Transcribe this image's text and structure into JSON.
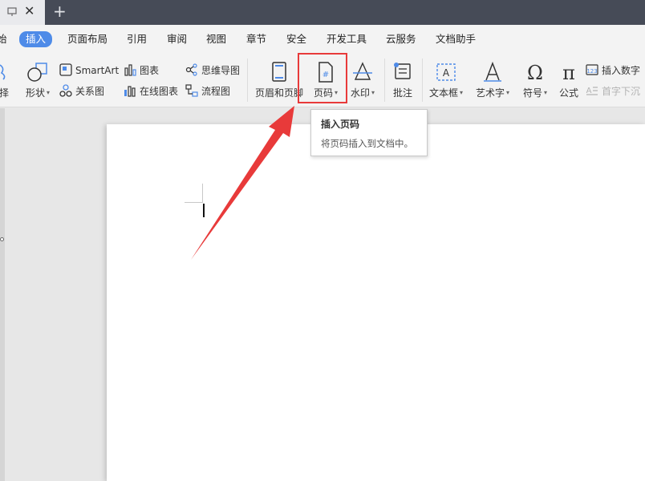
{
  "titlebar": {
    "new_tab_label": "+"
  },
  "menu": {
    "items": [
      {
        "label": "始"
      },
      {
        "label": "插入"
      },
      {
        "label": "页面布局"
      },
      {
        "label": "引用"
      },
      {
        "label": "审阅"
      },
      {
        "label": "视图"
      },
      {
        "label": "章节"
      },
      {
        "label": "安全"
      },
      {
        "label": "开发工具"
      },
      {
        "label": "云服务"
      },
      {
        "label": "文档助手"
      }
    ],
    "active_index": 1
  },
  "toolbar": {
    "partial_left": "择",
    "shape": "形状",
    "smartart": "SmartArt",
    "relation": "关系图",
    "chart": "图表",
    "online_chart": "在线图表",
    "mindmap": "思维导图",
    "flowchart": "流程图",
    "header_footer": "页眉和页脚",
    "page_number": "页码",
    "watermark": "水印",
    "comment": "批注",
    "textbox": "文本框",
    "art_text": "艺术字",
    "symbol": "符号",
    "formula": "公式",
    "insert_number": "插入数字",
    "drop_cap": "首字下沉"
  },
  "tooltip": {
    "title": "插入页码",
    "description": "将页码插入到文档中。"
  },
  "colors": {
    "accent": "#4e8be8",
    "highlight": "#e83a3a",
    "titlebar": "#464b57"
  }
}
